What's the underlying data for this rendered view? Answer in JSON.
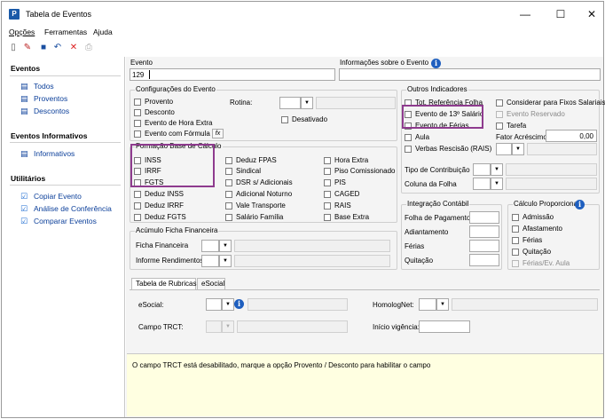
{
  "window": {
    "title": "Tabela de Eventos",
    "minimize": "—",
    "maximize": "☐",
    "close": "✕"
  },
  "menu": [
    "Opções",
    "Ferramentas",
    "Ajuda"
  ],
  "toolbar": {
    "icons": [
      "new-document-icon",
      "edit-pencil-icon",
      "save-icon",
      "undo-icon",
      "delete-icon",
      "print-icon"
    ]
  },
  "sidebar": {
    "sections": [
      {
        "title": "Eventos",
        "items": [
          {
            "label": "Todos",
            "icon": "events-list-icon"
          },
          {
            "label": "Proventos",
            "icon": "events-list-icon"
          },
          {
            "label": "Descontos",
            "icon": "events-list-icon"
          }
        ]
      },
      {
        "title": "Eventos Informativos",
        "items": [
          {
            "label": "Informativos",
            "icon": "events-list-icon"
          }
        ]
      },
      {
        "title": "Utilitários",
        "items": [
          {
            "label": "Copiar Evento",
            "icon": "checkmark-icon"
          },
          {
            "label": "Análise de Conferência",
            "icon": "checkmark-icon"
          },
          {
            "label": "Comparar Eventos",
            "icon": "checkmark-icon"
          }
        ]
      }
    ]
  },
  "form": {
    "evento_label": "Evento",
    "evento_value": "129",
    "info_label": "Informações sobre o Evento",
    "config": {
      "title": "Configurações do Evento",
      "provento": "Provento",
      "desconto": "Desconto",
      "hora_extra": "Evento de Hora Extra",
      "com_formula": "Evento com Fórmula",
      "formula_icon": "fx",
      "rotina": "Rotina:",
      "desativado": "Desativado"
    },
    "formacao": {
      "title": "Formação Base de Cálculo",
      "col1": [
        "INSS",
        "IRRF",
        "FGTS",
        "Deduz INSS",
        "Deduz IRRF",
        "Deduz FGTS"
      ],
      "col2": [
        "Deduz FPAS",
        "Sindical",
        "DSR s/ Adicionais",
        "Adicional Noturno",
        "Vale Transporte",
        "Salário Família"
      ],
      "col3": [
        "Hora Extra",
        "Piso Comissionado",
        "PIS",
        "CAGED",
        "RAIS",
        "Base Extra"
      ]
    },
    "acumulo": {
      "title": "Acúmulo Ficha Financeira",
      "ficha": "Ficha Financeira",
      "informe": "Informe Rendimentos"
    },
    "outros": {
      "title": "Outros Indicadores",
      "tot_ref": "Tot. Referência Folha",
      "considerar": "Considerar para Fixos Salariais",
      "evento_13": "Evento de 13º Salário",
      "evento_reservado": "Evento Reservado",
      "evento_ferias": "Evento de Férias",
      "tarefa": "Tarefa",
      "aula": "Aula",
      "fator_label": "Fator Acréscimo",
      "fator_value": "0,00",
      "verbas": "Verbas Rescisão (RAIS)",
      "tipo_contrib": "Tipo de Contribuição",
      "coluna_folha": "Coluna da Folha"
    },
    "integracao": {
      "title": "Integração Contábil",
      "items": [
        "Folha de Pagamento",
        "Adiantamento",
        "Férias",
        "Quitação"
      ]
    },
    "calculo": {
      "title": "Cálculo Proporcional",
      "items": [
        "Admissão",
        "Afastamento",
        "Férias",
        "Quitação",
        "Férias/Ev. Aula"
      ]
    },
    "tabs": [
      "Tabela de Rubricas",
      "eSocial"
    ],
    "rubricas": {
      "esocial": "eSocial:",
      "homolognet": "HomologNet:",
      "campo_trct": "Campo TRCT:",
      "inicio_vigencia": "Início vigência:"
    },
    "message": "O campo TRCT está desabilitado, marque a opção Provento / Desconto para habilitar o campo"
  }
}
